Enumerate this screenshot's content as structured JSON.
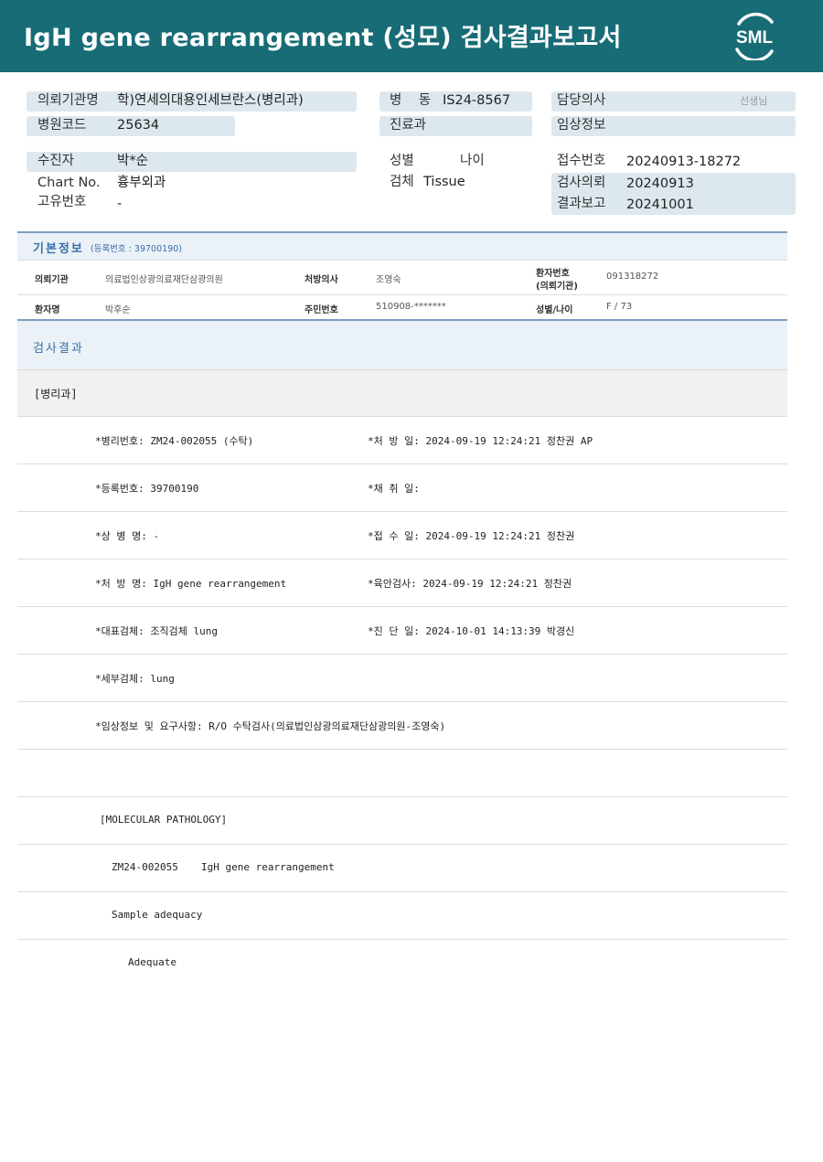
{
  "header": {
    "title": "IgH gene rearrangement (성모) 검사결과보고서",
    "logo_text": "SML"
  },
  "info": {
    "request_org_label": "의뢰기관명",
    "request_org_value": "학)연세의대용인세브란스(병리과)",
    "hospital_code_label": "병원코드",
    "hospital_code_value": "25634",
    "ward_label": "병    동",
    "ward_value": "IS24-8567",
    "dept_label": "진료과",
    "doctor_label": "담당의사",
    "doctor_suffix": "선생님",
    "clinical_label": "임상정보",
    "patient_label": "수진자",
    "patient_value": "박*순",
    "chart_label": "Chart No.",
    "chart_value": "흉부외과",
    "unique_label": "고유번호",
    "unique_value": "-",
    "sex_label": "성별",
    "age_label": "나이",
    "specimen_label": "검체",
    "specimen_value": "Tissue",
    "receipt_label": "접수번호",
    "receipt_value": "20240913-18272",
    "request_label": "검사의뢰",
    "request_value": "20240913",
    "report_label": "결과보고",
    "report_value": "20241001"
  },
  "basic": {
    "title": "기본정보",
    "subtitle": "(등록번호 : 39700190)",
    "org_label": "의뢰기관",
    "org_value": "의료법인상광의료재단삼광의원",
    "prescriber_label": "처방의사",
    "prescriber_value": "조영숙",
    "patno_label_1": "환자번호",
    "patno_label_2": "(의뢰기관)",
    "patno_value": "091318272",
    "name_label": "환자명",
    "name_value": "박후순",
    "rrn_label": "주민번호",
    "rrn_value": "510908-*******",
    "sexage_label": "성별/나이",
    "sexage_value": "F / 73"
  },
  "results": {
    "title": "검사결과",
    "section": "[병리과]",
    "rows": [
      {
        "left": "*병리번호: ZM24-002055 (수탁)",
        "right": "*처 방 일: 2024-09-19 12:24:21  정찬권 AP"
      },
      {
        "left": "*등록번호: 39700190",
        "right": "*채 취 일:"
      },
      {
        "left": "*상 병 명: -",
        "right": "*접 수 일: 2024-09-19 12:24:21  정찬권"
      },
      {
        "left": "*처 방 명: IgH gene rearrangement",
        "right": "*육안검사: 2024-09-19 12:24:21  정찬권"
      },
      {
        "left": "*대표검체: 조직검체 lung",
        "right": "*진 단 일: 2024-10-01 14:13:39  박경신"
      },
      {
        "left": "*세부검체: lung",
        "right": ""
      },
      {
        "left": "*임상정보 및 요구사항: R/O 수탁검사(의료법인삼광의료재단삼광의원-조영숙)",
        "right": ""
      }
    ],
    "molecular_title": "[MOLECULAR PATHOLOGY]",
    "molecular_id": "ZM24-002055",
    "molecular_test": "IgH gene rearrangement",
    "adequacy_label": "Sample adequacy",
    "adequacy_value": "Adequate"
  },
  "colors": {
    "header_bg": "#176c76",
    "pill_bg": "#dde7ee",
    "accent_blue": "#3b6fa8"
  }
}
